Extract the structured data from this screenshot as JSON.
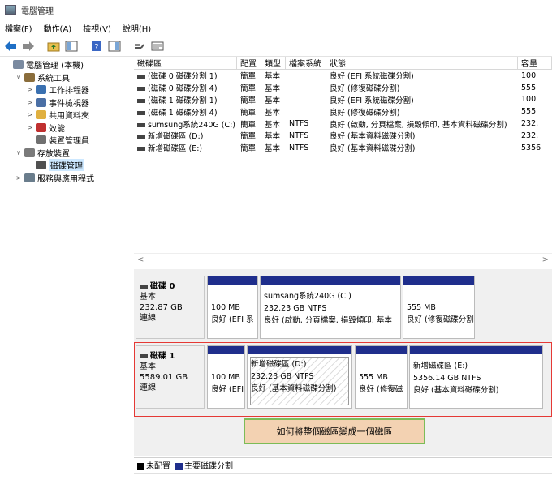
{
  "window": {
    "title": "電腦管理"
  },
  "menu": [
    "檔案(F)",
    "動作(A)",
    "檢視(V)",
    "說明(H)"
  ],
  "toolbar_icons": [
    "back-arrow-icon",
    "forward-arrow-icon",
    "folder-up-icon",
    "console-tree-icon",
    "help-icon",
    "action-pane-icon",
    "connect-icon",
    "properties-icon"
  ],
  "tree": [
    {
      "label": "電腦管理 (本機)",
      "depth": 0,
      "caret": "",
      "icon": "#7a8aa0"
    },
    {
      "label": "系統工具",
      "depth": 1,
      "caret": "∨",
      "icon": "#8a6d3b"
    },
    {
      "label": "工作排程器",
      "depth": 2,
      "caret": ">",
      "icon": "#3a70b0"
    },
    {
      "label": "事件檢視器",
      "depth": 2,
      "caret": ">",
      "icon": "#4a6fa5"
    },
    {
      "label": "共用資料夾",
      "depth": 2,
      "caret": ">",
      "icon": "#e0b040"
    },
    {
      "label": "效能",
      "depth": 2,
      "caret": ">",
      "icon": "#c03030"
    },
    {
      "label": "裝置管理員",
      "depth": 2,
      "caret": "",
      "icon": "#707070"
    },
    {
      "label": "存放裝置",
      "depth": 1,
      "caret": "∨",
      "icon": "#7a7a7a"
    },
    {
      "label": "磁碟管理",
      "depth": 2,
      "caret": "",
      "icon": "#505050",
      "selected": true
    },
    {
      "label": "服務與應用程式",
      "depth": 1,
      "caret": ">",
      "icon": "#6a7d8c"
    }
  ],
  "volume_table": {
    "headers": [
      "磁碟區",
      "配置",
      "類型",
      "檔案系統",
      "狀態",
      "容量"
    ],
    "rows": [
      [
        "(磁碟 0 磁碟分割 1)",
        "簡單",
        "基本",
        "",
        "良好 (EFI 系統磁碟分割)",
        "100"
      ],
      [
        "(磁碟 0 磁碟分割 4)",
        "簡單",
        "基本",
        "",
        "良好 (修復磁碟分割)",
        "555"
      ],
      [
        "(磁碟 1 磁碟分割 1)",
        "簡單",
        "基本",
        "",
        "良好 (EFI 系統磁碟分割)",
        "100"
      ],
      [
        "(磁碟 1 磁碟分割 4)",
        "簡單",
        "基本",
        "",
        "良好 (修復磁碟分割)",
        "555"
      ],
      [
        "sumsung系統240G (C:)",
        "簡單",
        "基本",
        "NTFS",
        "良好 (啟動, 分頁檔案, 損毀傾印, 基本資料磁碟分割)",
        "232."
      ],
      [
        "新增磁碟區 (D:)",
        "簡單",
        "基本",
        "NTFS",
        "良好 (基本資料磁碟分割)",
        "232."
      ],
      [
        "新增磁碟區 (E:)",
        "簡單",
        "基本",
        "NTFS",
        "良好 (基本資料磁碟分割)",
        "5356"
      ]
    ]
  },
  "disks": [
    {
      "name": "磁碟 0",
      "type": "基本",
      "size": "232.87 GB",
      "status": "連線",
      "partitions": [
        {
          "title": "",
          "size": "100 MB",
          "status": "良好 (EFI 系",
          "hatched": false
        },
        {
          "title": "sumsang系統240G  (C:)",
          "size": "232.23 GB NTFS",
          "status": "良好 (啟動, 分頁檔案, 損毀傾印, 基本",
          "hatched": false
        },
        {
          "title": "",
          "size": "555 MB",
          "status": "良好 (修復磁碟分割)",
          "hatched": false
        }
      ]
    },
    {
      "name": "磁碟 1",
      "type": "基本",
      "size": "5589.01 GB",
      "status": "連線",
      "partitions": [
        {
          "title": "",
          "size": "100 MB",
          "status": "良好 (EFI",
          "hatched": false
        },
        {
          "title": "新增磁碟區  (D:)",
          "size": "232.23 GB NTFS",
          "status": "良好 (基本資料磁碟分割)",
          "hatched": true
        },
        {
          "title": "",
          "size": "555 MB",
          "status": "良好 (修復磁",
          "hatched": false
        },
        {
          "title": "新增磁碟區  (E:)",
          "size": "5356.14 GB NTFS",
          "status": "良好 (基本資料磁碟分割)",
          "hatched": false
        }
      ]
    }
  ],
  "annotation": "如何將整個磁區變成一個磁區",
  "legend": [
    {
      "label": "未配置",
      "color": "#000000"
    },
    {
      "label": "主要磁碟分割",
      "color": "#1f2e8c"
    }
  ]
}
